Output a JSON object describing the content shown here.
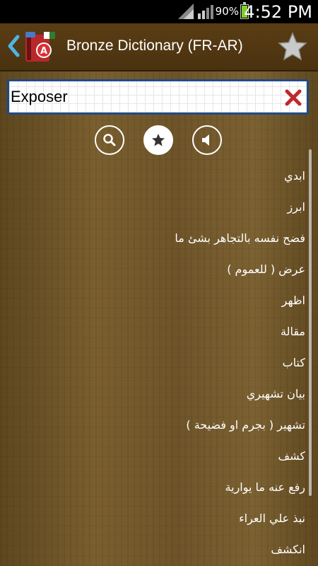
{
  "status_bar": {
    "battery_percent": "90%",
    "time": "4:52 PM",
    "battery_color": "#7fcf2a"
  },
  "app_bar": {
    "title": "Bronze Dictionary (FR-AR)",
    "back_icon": "chevron-left-icon",
    "logo_icon": "app-logo-icon",
    "favorite_icon": "star-icon"
  },
  "search": {
    "value": "Exposer",
    "clear_icon": "close-icon"
  },
  "modes": [
    {
      "name": "search",
      "icon": "search-icon",
      "active": false
    },
    {
      "name": "favorites",
      "icon": "star-icon",
      "active": true
    },
    {
      "name": "pronounce",
      "icon": "speaker-icon",
      "active": false
    }
  ],
  "results": [
    "ابدي",
    "ابرز",
    "فضح نفسه بالتجاهر بشئ ما",
    "عرض ( للعموم )",
    "اظهر",
    "مقالة",
    "كتاب",
    "بيان تشهيري",
    "تشهير ( بجرم او فضيحة )",
    "كشف",
    "رفع عنه ما يوارية",
    "نبذ علي العراء",
    "انكشف"
  ],
  "colors": {
    "app_bar_bg": "#4a3210",
    "search_border": "#1f4b86",
    "clear_icon": "#c0282c",
    "text": "#ffffff"
  }
}
